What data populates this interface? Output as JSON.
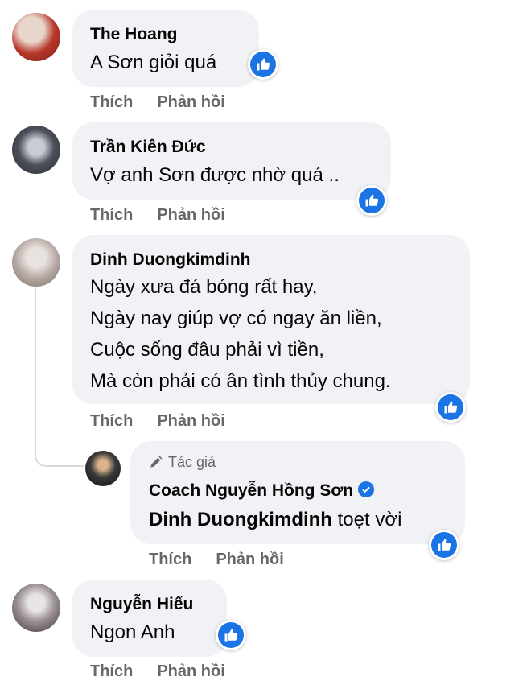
{
  "actions": {
    "like": "Thích",
    "reply": "Phản hồi"
  },
  "comments": [
    {
      "author": "The Hoang",
      "text": "A Sơn giỏi quá"
    },
    {
      "author": "Trần Kiên Đức",
      "text": "Vợ anh Sơn được nhờ quá .."
    },
    {
      "author": "Dinh Duongkimdinh",
      "lines": [
        "Ngày xưa đá bóng rất hay,",
        "Ngày nay giúp vợ có ngay ăn liền,",
        "Cuộc sống đâu phải vì tiền,",
        "Mà còn phải có ân tình thủy chung."
      ]
    },
    {
      "author": "Nguyễn Hiếu",
      "text": "Ngon Anh"
    }
  ],
  "reply": {
    "badge": "Tác giả",
    "author": "Coach Nguyễn Hồng Sơn",
    "mention": "Dinh Duongkimdinh",
    "text": " toẹt vời"
  },
  "colors": {
    "bubble": "#f0f2f5",
    "like_blue": "#1b74e4",
    "action_gray": "#65676b"
  },
  "icons": {
    "reaction": "like-icon",
    "badge": "pen-icon",
    "verified": "verified-check-icon"
  }
}
